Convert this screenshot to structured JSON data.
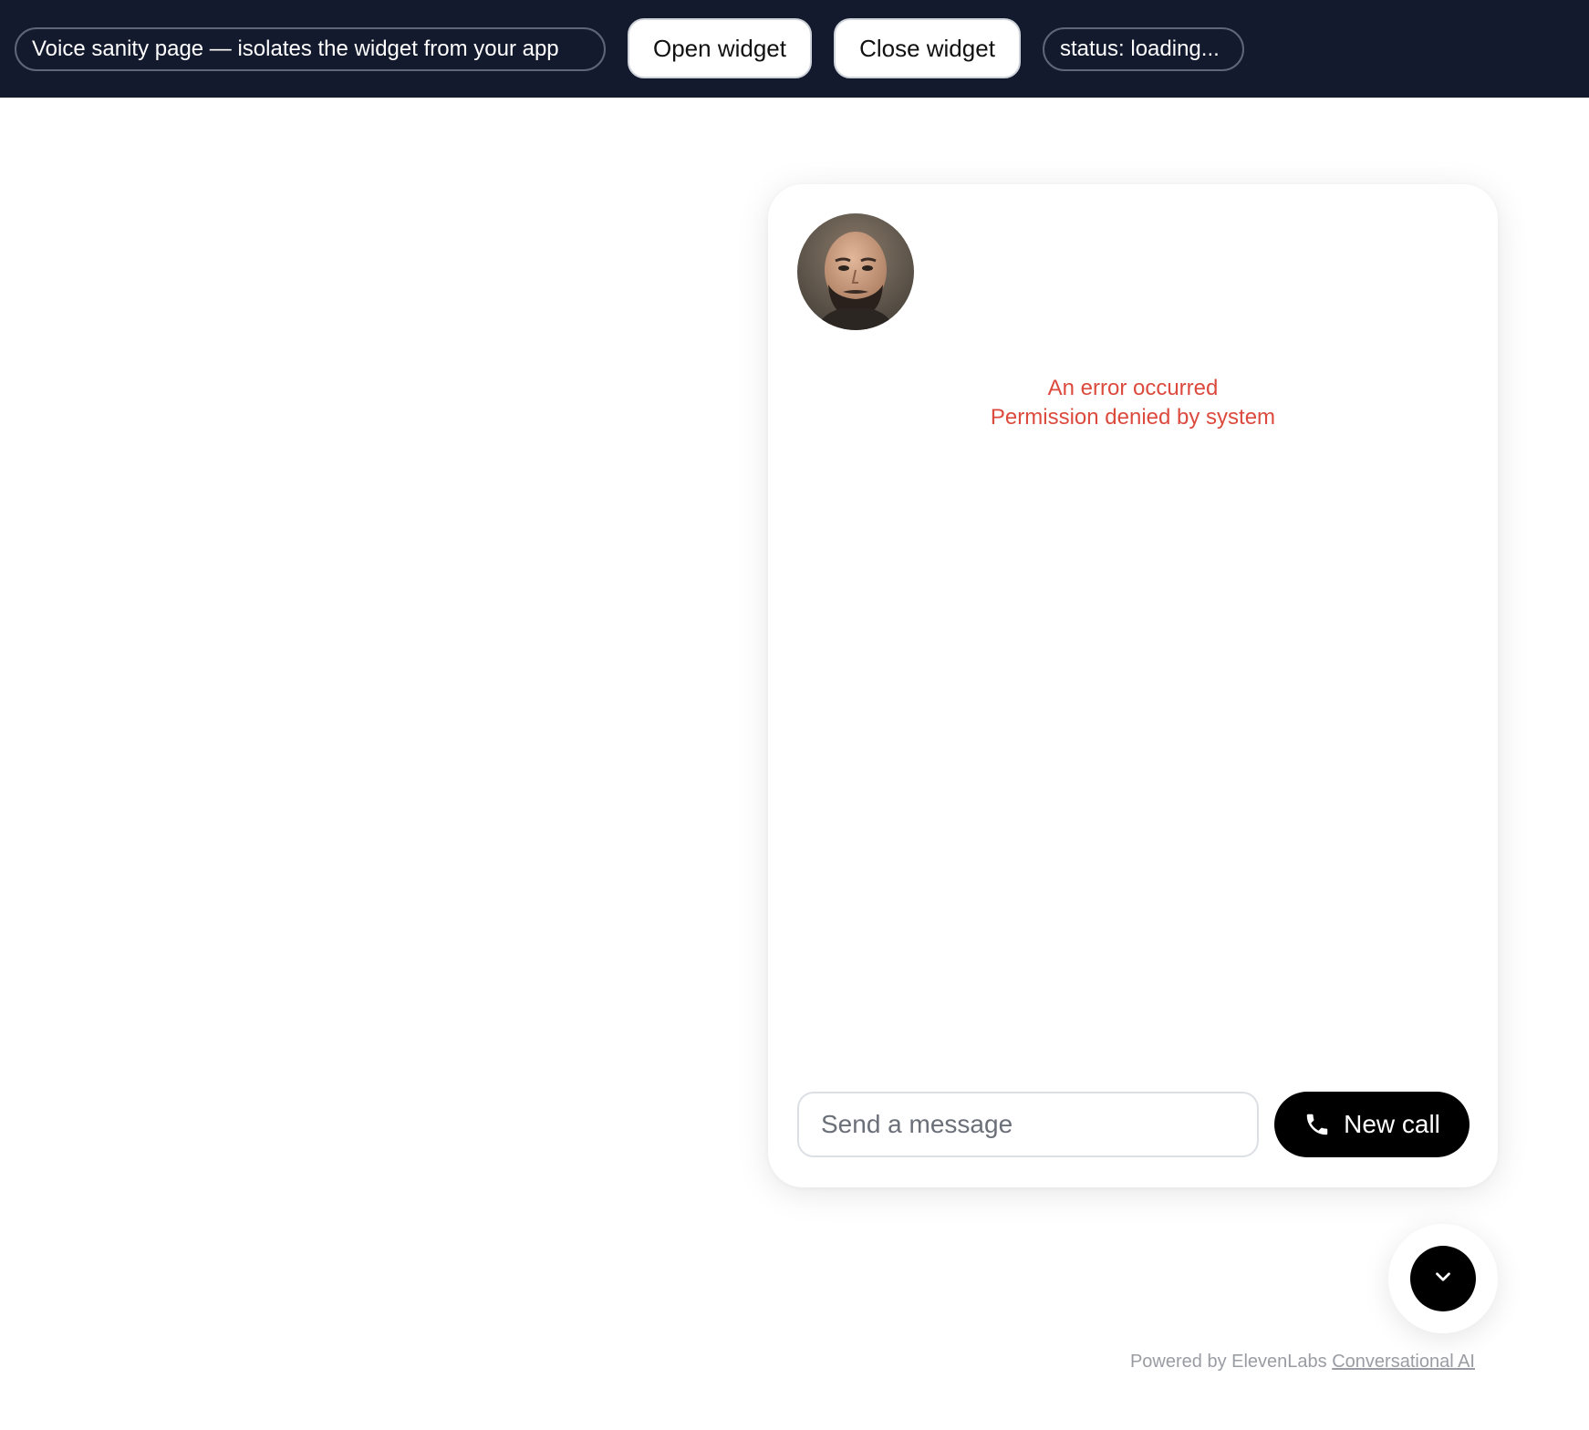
{
  "topbar": {
    "title_pill": "Voice sanity page — isolates the widget from your app",
    "open_label": "Open widget",
    "close_label": "Close widget",
    "status_pill": "status: loading..."
  },
  "widget": {
    "error_title": "An error occurred",
    "error_detail": "Permission denied by system",
    "message_placeholder": "Send a message",
    "new_call_label": "New call",
    "icons": {
      "call": "phone-icon",
      "collapse": "chevron-down-icon"
    },
    "accent_color": "#000000",
    "error_color": "#dc4a3d"
  },
  "footer": {
    "powered_prefix": "Powered by ElevenLabs",
    "powered_link": "Conversational AI"
  }
}
